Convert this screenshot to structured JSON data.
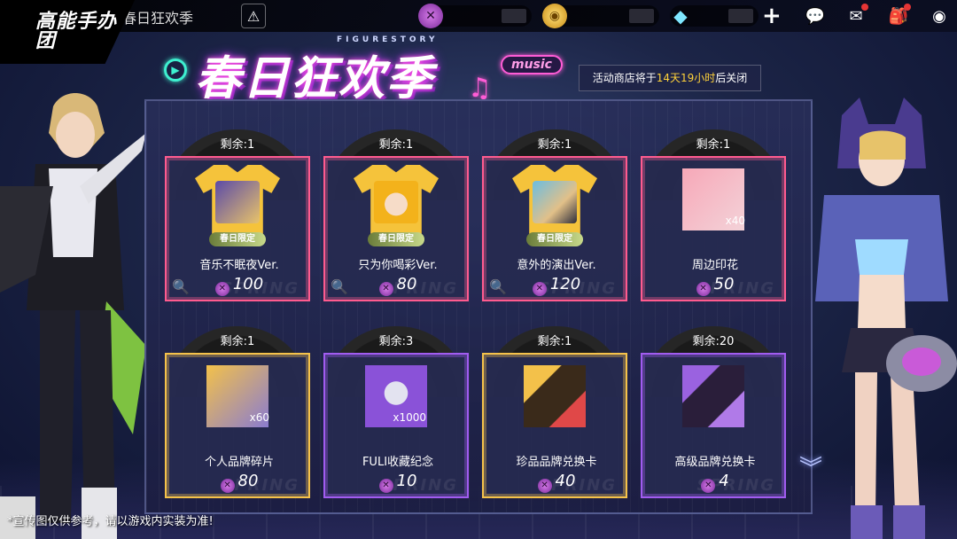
{
  "topbar": {
    "page_title": "春日狂欢季",
    "logo_text": "高能手办团",
    "currencies": [
      {
        "name": "purple-coin",
        "value": ""
      },
      {
        "name": "gold-coin",
        "value": ""
      },
      {
        "name": "diamond",
        "value": ""
      }
    ]
  },
  "banner": {
    "figure_story": "FIGURESTORY",
    "title": "春日狂欢季",
    "music": "music",
    "notice_prefix": "活动商店将于",
    "notice_highlight": "14天19小时",
    "notice_suffix": "后关闭"
  },
  "items": [
    {
      "remaining": "剩余:1",
      "name": "音乐不眠夜Ver.",
      "price": "100",
      "tag": "春日限定",
      "qty": ""
    },
    {
      "remaining": "剩余:1",
      "name": "只为你喝彩Ver.",
      "price": "80",
      "tag": "春日限定",
      "qty": ""
    },
    {
      "remaining": "剩余:1",
      "name": "意外的演出Ver.",
      "price": "120",
      "tag": "春日限定",
      "qty": ""
    },
    {
      "remaining": "剩余:1",
      "name": "周边印花",
      "price": "50",
      "tag": "",
      "qty": "x40"
    },
    {
      "remaining": "剩余:1",
      "name": "个人品牌碎片",
      "price": "80",
      "tag": "",
      "qty": "x60"
    },
    {
      "remaining": "剩余:3",
      "name": "FULI收藏纪念",
      "price": "10",
      "tag": "",
      "qty": "x1000"
    },
    {
      "remaining": "剩余:1",
      "name": "珍品品牌兑换卡",
      "price": "40",
      "tag": "",
      "qty": ""
    },
    {
      "remaining": "剩余:20",
      "name": "高级品牌兑换卡",
      "price": "4",
      "tag": "",
      "qty": ""
    }
  ],
  "watermark": "SPRING",
  "disclaimer": "*宣传图仅供参考，请以游戏内实装为准!",
  "colors": {
    "pink": "#ff5b8f",
    "gold": "#f5c24a",
    "purple": "#a15cf0",
    "highlight": "#ffd23a"
  }
}
